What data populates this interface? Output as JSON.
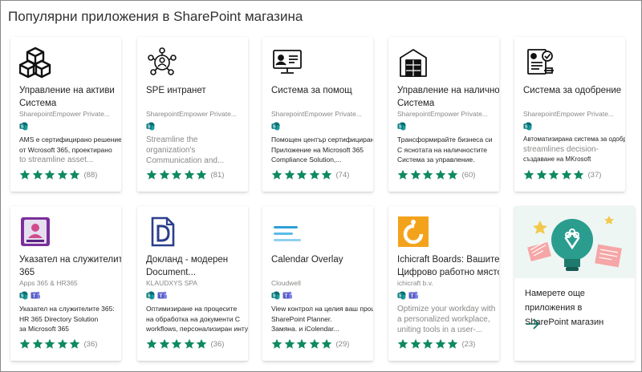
{
  "page": {
    "title": "Популярни приложения в SharePoint магазина"
  },
  "colors": {
    "star": "#0f8a60",
    "sharepoint": "#03787c",
    "teams": "#5b5fc7"
  },
  "apps": [
    {
      "title_line1": "Управление на активи",
      "title_line2": "Система",
      "publisher": "SharepointEmpower Private...",
      "desc_line1": "AMS е сертифицирано решение",
      "desc_line2": "от  Wcrosoft 365, проектирано",
      "desc_line3": "to streamline asset...",
      "rating": 5,
      "count": "(88)",
      "icon": "boxes-icon",
      "teams": false
    },
    {
      "title_line1": "SPE интранет",
      "title_line2": "",
      "publisher": "SharepointEmpower Private...",
      "desc_line1": "Streamline the",
      "desc_line2": "organization's",
      "desc_line3": "Communication and...",
      "rating": 5,
      "count": "(81)",
      "icon": "people-network-icon",
      "teams": false
    },
    {
      "title_line1": "Система за помощ",
      "title_line2": "",
      "publisher": "SharepointEmpower Private...",
      "desc_line1": "Помощен център сертифициран",
      "desc_line2": "Приложение на Microsoft 365",
      "desc_line3": "Compliance Solution,...",
      "rating": 5,
      "count": "(74)",
      "icon": "helpdesk-icon",
      "teams": false
    },
    {
      "title_line1": "Управление на наличности",
      "title_line2": "Система",
      "publisher": "SharepointEmpower Private...",
      "desc_line1": "Трансформирайте бизнеса си",
      "desc_line2": "С яснотата на наличностите",
      "desc_line3": "Система за управление.",
      "rating": 5,
      "count": "(60)",
      "icon": "warehouse-icon",
      "teams": false
    },
    {
      "title_line1": "Система за одобрение",
      "title_line2": "",
      "publisher": "SharepointEmpower Private...",
      "desc_line1": "Автоматизирана система за одобрение",
      "desc_line2": "streamlines decision-",
      "desc_line3": "създаване на MKrosoft",
      "rating": 5,
      "count": "(37)",
      "icon": "approval-icon",
      "teams": false
    },
    {
      "title_line1": "Указател на служителите",
      "title_line2": "365",
      "publisher": "Apps 365 & HR365",
      "desc_line1": "Указател на служителите 365:",
      "desc_line2": "HR 365 Directory Solution",
      "desc_line3": "за Microsoft 365",
      "rating": 5,
      "count": "(36)",
      "icon": "employee-directory-icon",
      "teams": true
    },
    {
      "title_line1": "Докланд - модерен",
      "title_line2": "Document...",
      "publisher": "KLAUDXYS SPA",
      "desc_line1": "Оптимизиране на процесите",
      "desc_line2": "на обработка на документи С",
      "desc_line3": "workflows,  персонализиран интуснасъм",
      "rating": 5,
      "count": "(36)",
      "icon": "dokland-logo-icon",
      "teams": true
    },
    {
      "title_line1": "Calendar Overlay",
      "title_line2": "",
      "publisher": "Cloudwell",
      "desc_line1": "View контрол на целия ваш процес на",
      "desc_line2": "SharePoint Planner.",
      "desc_line3": "Замяна. и iColendar...",
      "rating": 5,
      "count": "(29)",
      "icon": "calendar-lines-icon",
      "teams": true
    },
    {
      "title_line1": "Ichicraft Boards: Вашите",
      "title_line2": "Цифрово работно място",
      "publisher": "ichicraft b.v.",
      "desc_line1": "Optimize your workday with",
      "desc_line2": "a personalized workplace,",
      "desc_line3": "uniting tools in a user-...",
      "rating": 5,
      "count": "(23)",
      "icon": "ichicraft-logo-icon",
      "teams": true
    }
  ],
  "promo": {
    "line1": "Намерете още приложения в",
    "line2": "SharePoint магазин"
  }
}
